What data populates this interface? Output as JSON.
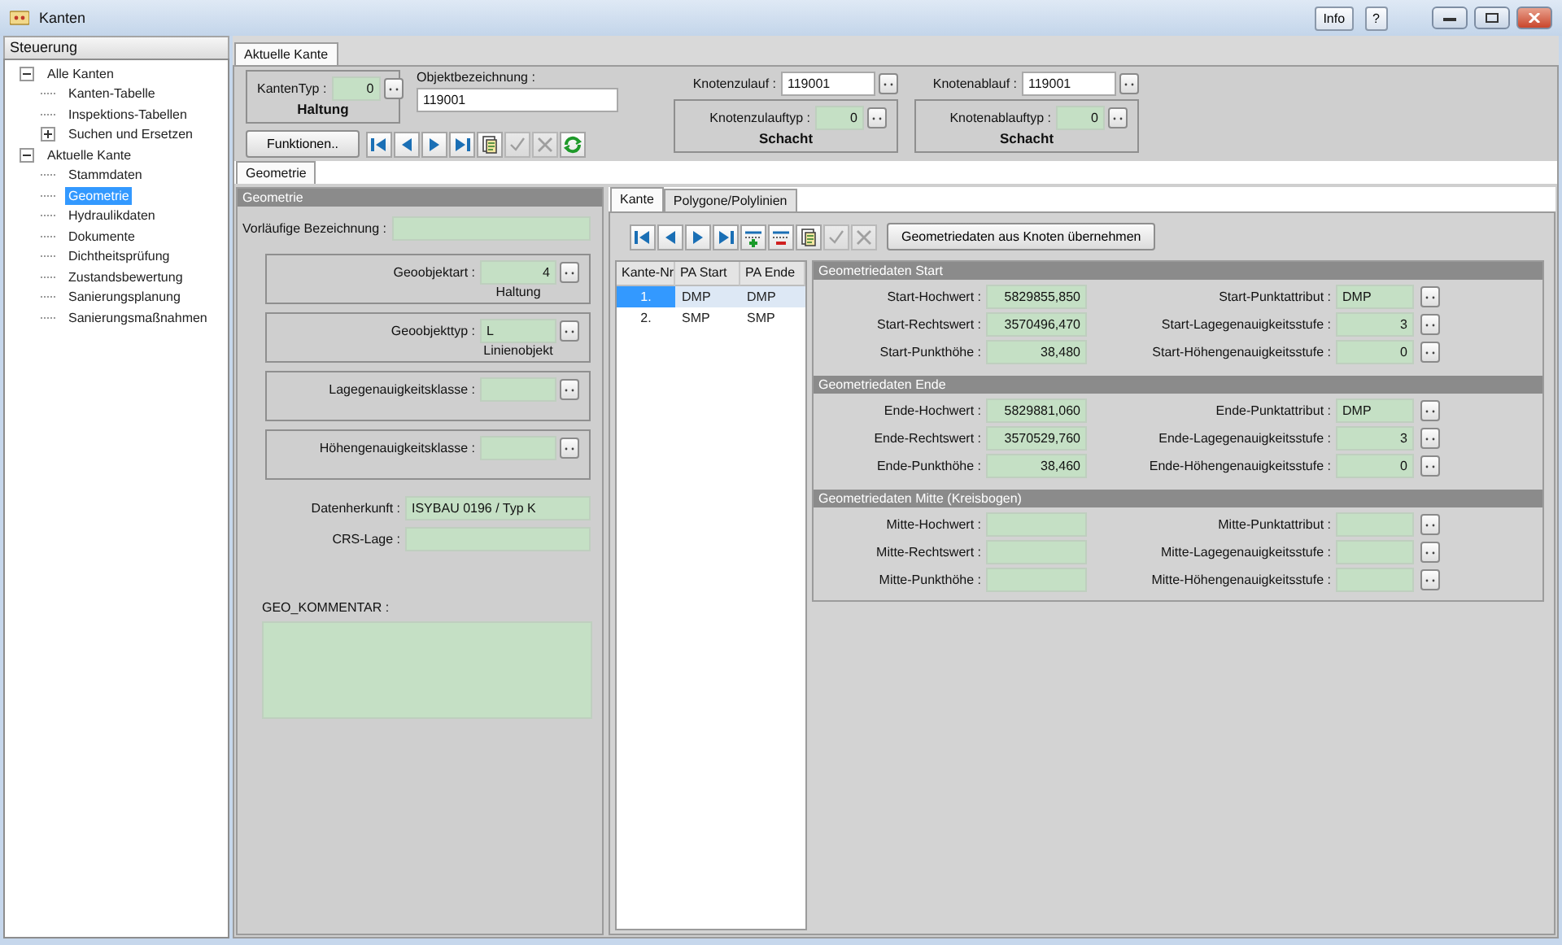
{
  "window": {
    "title": "Kanten",
    "buttons": [
      "Info",
      "?"
    ]
  },
  "sidebar": {
    "title": "Steuerung",
    "tree": [
      {
        "label": "Alle Kanten",
        "expanded": true,
        "selected": false,
        "children": [
          {
            "label": "Kanten-Tabelle",
            "selected": false
          },
          {
            "label": "Inspektions-Tabellen",
            "selected": false
          },
          {
            "label": "Suchen und Ersetzen",
            "expanded": false,
            "selected": false
          }
        ]
      },
      {
        "label": "Aktuelle Kante",
        "expanded": true,
        "selected": false,
        "children": [
          {
            "label": "Stammdaten",
            "selected": false
          },
          {
            "label": "Geometrie",
            "selected": true
          },
          {
            "label": "Hydraulikdaten",
            "selected": false
          },
          {
            "label": "Dokumente",
            "selected": false
          },
          {
            "label": "Dichtheitsprüfung",
            "selected": false
          },
          {
            "label": "Zustandsbewertung",
            "selected": false
          },
          {
            "label": "Sanierungsplanung",
            "selected": false
          },
          {
            "label": "Sanierungsmaßnahmen",
            "selected": false
          }
        ]
      }
    ]
  },
  "main_tabs": [
    {
      "label": "Aktuelle Kante",
      "selected": true
    }
  ],
  "header": {
    "kantentyp": {
      "label": "KantenTyp :",
      "value": "0",
      "caption": "Haltung"
    },
    "objekt": {
      "label": "Objektbezeichnung :",
      "value": "119001"
    },
    "functions_button": "Funktionen..",
    "toolbar": [
      {
        "kind": "first",
        "disabled": false
      },
      {
        "kind": "prev",
        "disabled": false
      },
      {
        "kind": "next",
        "disabled": false
      },
      {
        "kind": "last",
        "disabled": false
      },
      {
        "kind": "document",
        "disabled": false
      },
      {
        "kind": "save",
        "disabled": true
      },
      {
        "kind": "cancel",
        "disabled": true
      },
      {
        "kind": "refresh",
        "disabled": false
      }
    ],
    "knoten": [
      {
        "label": "Knotenzulauf :",
        "value": "119001",
        "type_label": "Knotenzulauftyp :",
        "type_value": "0",
        "caption": "Schacht"
      },
      {
        "label": "Knotenablauf :",
        "value": "119001",
        "type_label": "Knotenablauftyp :",
        "type_value": "0",
        "caption": "Schacht"
      }
    ]
  },
  "sub_tabs": [
    {
      "label": "Geometrie",
      "selected": true
    }
  ],
  "geometrie": {
    "title": "Geometrie",
    "vorlaeufig": {
      "label": "Vorläufige Bezeichnung :"
    },
    "groups": [
      {
        "label": "Geoobjektart :",
        "value": "4",
        "numeric": true,
        "caption": "Haltung"
      },
      {
        "label": "Geoobjekttyp :",
        "value": "L",
        "numeric": false,
        "caption": "Linienobjekt"
      },
      {
        "label": "Lagegenauigkeitsklasse :"
      },
      {
        "label": "Höhengenauigkeitsklasse :"
      }
    ],
    "fields": [
      {
        "label": "Datenherkunft :",
        "value": "ISYBAU 0196 / Typ K"
      },
      {
        "label": "CRS-Lage :"
      }
    ],
    "kommentar": {
      "label": "GEO_KOMMENTAR :"
    }
  },
  "detail": {
    "tabs": [
      {
        "label": "Kante",
        "selected": true
      },
      {
        "label": "Polygone/Polylinien",
        "selected": false
      }
    ],
    "toolbar": [
      {
        "kind": "first",
        "disabled": false
      },
      {
        "kind": "prev",
        "disabled": false
      },
      {
        "kind": "next",
        "disabled": false
      },
      {
        "kind": "last",
        "disabled": false
      },
      {
        "kind": "add_row",
        "disabled": false
      },
      {
        "kind": "remove_row",
        "disabled": false
      },
      {
        "kind": "document",
        "disabled": false
      },
      {
        "kind": "save",
        "disabled": true
      },
      {
        "kind": "cancel",
        "disabled": true
      }
    ],
    "button": "Geometriedaten aus Knoten übernehmen",
    "table": {
      "columns": [
        "Kante-Nr",
        "PA Start",
        "PA Ende"
      ],
      "rows": [
        {
          "cells": [
            "1.",
            "DMP",
            "DMP"
          ],
          "selected": true
        },
        {
          "cells": [
            "2.",
            "SMP",
            "SMP"
          ],
          "selected": false
        }
      ]
    },
    "sections": [
      {
        "title": "Geometriedaten Start",
        "rows": [
          {
            "label": "Start-Hochwert :",
            "value": "5829855,850",
            "right_label": "Start-Punktattribut :",
            "right_value": "DMP",
            "right_numeric": false
          },
          {
            "label": "Start-Rechtswert :",
            "value": "3570496,470",
            "right_label": "Start-Lagegenauigkeitsstufe :",
            "right_value": "3",
            "right_numeric": true
          },
          {
            "label": "Start-Punkthöhe :",
            "value": "38,480",
            "right_label": "Start-Höhengenauigkeitsstufe :",
            "right_value": "0",
            "right_numeric": true
          }
        ]
      },
      {
        "title": "Geometriedaten Ende",
        "rows": [
          {
            "label": "Ende-Hochwert :",
            "value": "5829881,060",
            "right_label": "Ende-Punktattribut :",
            "right_value": "DMP",
            "right_numeric": false
          },
          {
            "label": "Ende-Rechtswert :",
            "value": "3570529,760",
            "right_label": "Ende-Lagegenauigkeitsstufe :",
            "right_value": "3",
            "right_numeric": true
          },
          {
            "label": "Ende-Punkthöhe :",
            "value": "38,460",
            "right_label": "Ende-Höhengenauigkeitsstufe :",
            "right_value": "0",
            "right_numeric": true
          }
        ]
      },
      {
        "title": "Geometriedaten Mitte (Kreisbogen)",
        "rows": [
          {
            "label": "Mitte-Hochwert :",
            "right_label": "Mitte-Punktattribut :"
          },
          {
            "label": "Mitte-Rechtswert :",
            "right_label": "Mitte-Lagegenauigkeitsstufe :"
          },
          {
            "label": "Mitte-Punkthöhe :",
            "right_label": "Mitte-Höhengenauigkeitsstufe :"
          }
        ]
      }
    ]
  }
}
